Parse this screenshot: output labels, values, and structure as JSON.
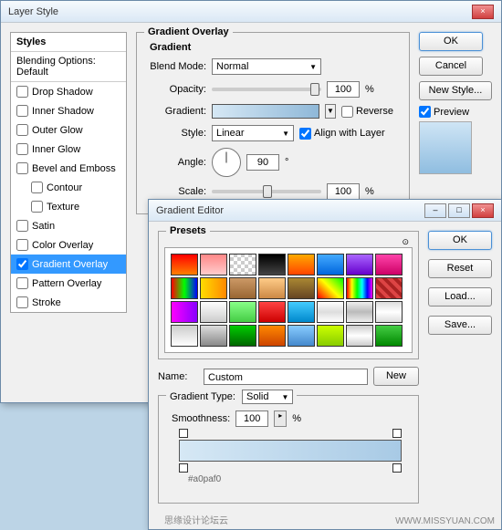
{
  "layerStyle": {
    "title": "Layer Style",
    "sidebar": {
      "heading": "Styles",
      "blending": "Blending Options: Default",
      "items": [
        {
          "label": "Drop Shadow",
          "checked": false,
          "indent": false
        },
        {
          "label": "Inner Shadow",
          "checked": false,
          "indent": false
        },
        {
          "label": "Outer Glow",
          "checked": false,
          "indent": false
        },
        {
          "label": "Inner Glow",
          "checked": false,
          "indent": false
        },
        {
          "label": "Bevel and Emboss",
          "checked": false,
          "indent": false
        },
        {
          "label": "Contour",
          "checked": false,
          "indent": true
        },
        {
          "label": "Texture",
          "checked": false,
          "indent": true
        },
        {
          "label": "Satin",
          "checked": false,
          "indent": false
        },
        {
          "label": "Color Overlay",
          "checked": false,
          "indent": false
        },
        {
          "label": "Gradient Overlay",
          "checked": true,
          "indent": false,
          "selected": true
        },
        {
          "label": "Pattern Overlay",
          "checked": false,
          "indent": false
        },
        {
          "label": "Stroke",
          "checked": false,
          "indent": false
        }
      ]
    },
    "section": {
      "title": "Gradient Overlay",
      "subTitle": "Gradient",
      "blendModeLabel": "Blend Mode:",
      "blendMode": "Normal",
      "opacityLabel": "Opacity:",
      "opacity": "100",
      "pct": "%",
      "gradientLabel": "Gradient:",
      "reverseLabel": "Reverse",
      "styleLabel": "Style:",
      "style": "Linear",
      "alignLabel": "Align with Layer",
      "angleLabel": "Angle:",
      "angle": "90",
      "deg": "°",
      "scaleLabel": "Scale:",
      "scale": "100"
    },
    "buttons": {
      "ok": "OK",
      "cancel": "Cancel",
      "newStyle": "New Style...",
      "preview": "Preview"
    }
  },
  "gradientEditor": {
    "title": "Gradient Editor",
    "presetsLabel": "Presets",
    "nameLabel": "Name:",
    "name": "Custom",
    "newBtn": "New",
    "typeLabel": "Gradient Type:",
    "type": "Solid",
    "smoothLabel": "Smoothness:",
    "smooth": "100",
    "pct": "%",
    "hex": "#a0paf0",
    "buttons": {
      "ok": "OK",
      "reset": "Reset",
      "load": "Load...",
      "save": "Save..."
    },
    "presets": [
      "linear-gradient(to bottom,#f00,#ff8000)",
      "linear-gradient(to bottom,#f88,#fcc)",
      "repeating-conic-gradient(#ccc 0 25%,#fff 0 50%) 0/8px 8px",
      "linear-gradient(to bottom,#000,#444)",
      "linear-gradient(to bottom,#fa0,#f40)",
      "linear-gradient(to bottom,#4af,#06d)",
      "linear-gradient(to bottom,#a6f,#60c)",
      "linear-gradient(to bottom,#f4a,#c06)",
      "linear-gradient(to right,#f00,#0f0,#00f)",
      "linear-gradient(to right,#fd0,#f80)",
      "linear-gradient(to bottom,#c96,#963)",
      "linear-gradient(to bottom,#fc8,#c84)",
      "linear-gradient(to bottom,#a83,#642)",
      "linear-gradient(45deg,#f00,#ff0,#0f0)",
      "linear-gradient(to right,#f00,#ff0,#0f0,#0ff,#00f,#f0f)",
      "repeating-linear-gradient(45deg,#d44 0 4px,#a22 4px 8px)",
      "linear-gradient(to right,#f0f,#80f)",
      "linear-gradient(to bottom,#fff,#ccc)",
      "linear-gradient(to bottom,#8f8,#4c4)",
      "linear-gradient(to bottom,#f44,#c00)",
      "linear-gradient(to bottom,#4cf,#08c)",
      "linear-gradient(to bottom,#fff,#ddd,#fff)",
      "linear-gradient(to bottom,#eee,#bbb,#eee)",
      "linear-gradient(to bottom,#ddd,#fff,#ddd)",
      "linear-gradient(to bottom,#ccc,#fff)",
      "linear-gradient(to bottom,#ddd,#888)",
      "linear-gradient(to bottom,#0c0,#060)",
      "linear-gradient(to bottom,#f80,#c40)",
      "linear-gradient(to bottom,#8cf,#48c)",
      "linear-gradient(to bottom,#cf0,#8c0)",
      "linear-gradient(to bottom,#ccc,#fff,#ccc)",
      "linear-gradient(to bottom,#4c4,#080)"
    ]
  },
  "watermark": "WWW.MISSYUAN.COM",
  "watermark2": "思缘设计论坛云"
}
